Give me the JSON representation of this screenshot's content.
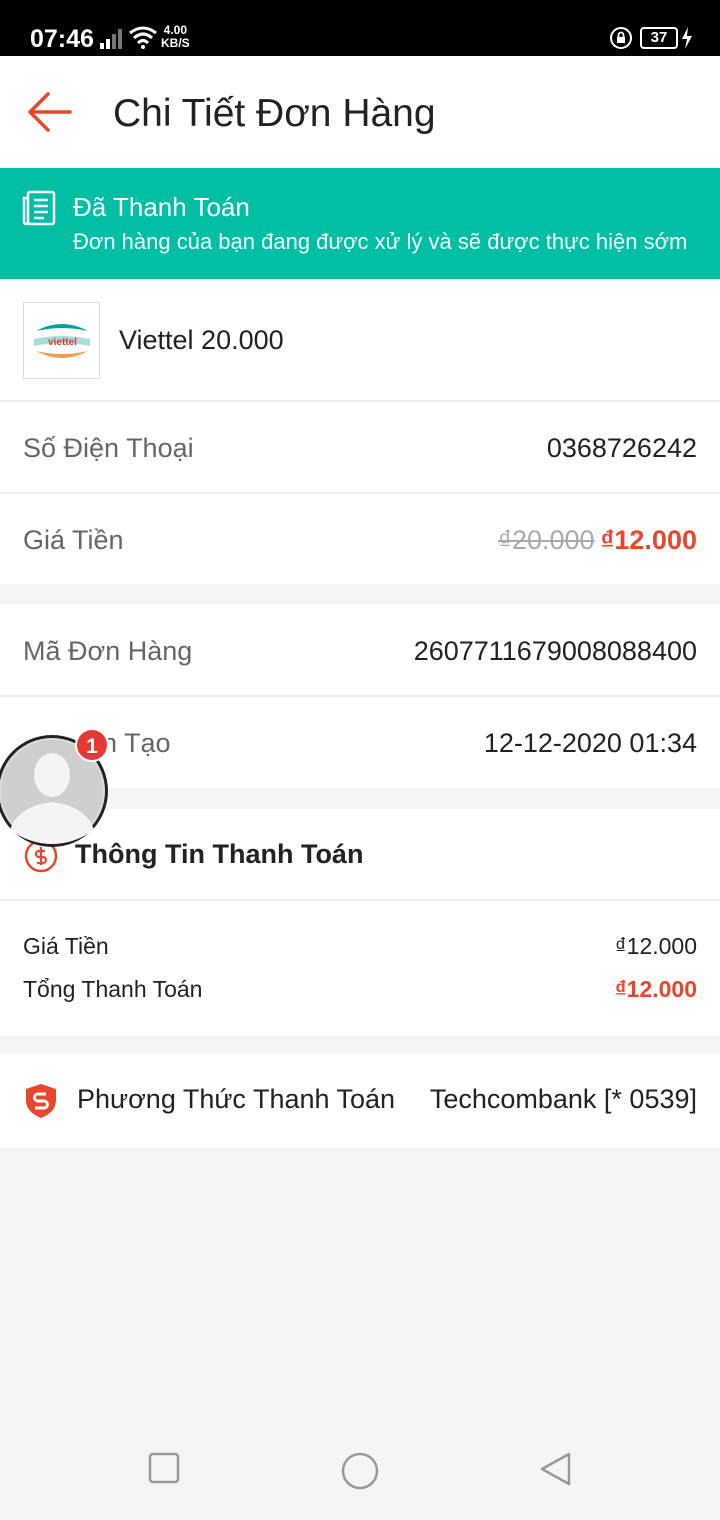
{
  "status_bar": {
    "time": "07:46",
    "net_speed_value": "4.00",
    "net_speed_unit": "KB/S",
    "battery": "37"
  },
  "header": {
    "title": "Chi Tiết Đơn Hàng"
  },
  "status_banner": {
    "title": "Đã Thanh Toán",
    "subtitle": "Đơn hàng của bạn đang được xử lý và sẽ được thực hiện sớm"
  },
  "product": {
    "logo_text": "viettel",
    "name": "Viettel 20.000"
  },
  "order_rows": {
    "phone_label": "Số Điện Thoại",
    "phone_value": "0368726242",
    "price_label": "Giá Tiền",
    "price_old": "₫20.000",
    "price_new": "₫12.000",
    "order_id_label": "Mã Đơn Hàng",
    "order_id_value": "2607711679008088400",
    "created_label": "Thời Gian Tạo",
    "created_visible_fragment": "an Tạo",
    "created_value": "12-12-2020 01:34"
  },
  "payment_info": {
    "section_title": "Thông Tin Thanh Toán",
    "price_label": "Giá Tiền",
    "price_value": "₫12.000",
    "total_label": "Tổng Thanh Toán",
    "total_value": "₫12.000"
  },
  "payment_method": {
    "label": "Phương Thức Thanh Toán",
    "value": "Techcombank [* 0539]"
  },
  "chat_head": {
    "badge_count": "1"
  },
  "colors": {
    "accent_red": "#e8472e",
    "banner_teal": "#00bfa5"
  }
}
